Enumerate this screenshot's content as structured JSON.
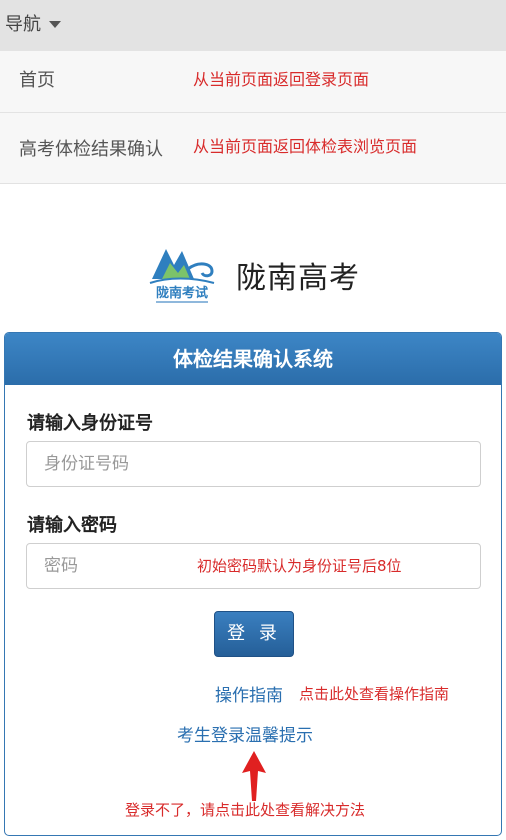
{
  "topbar": {
    "nav_label": "导航"
  },
  "menu": {
    "items": [
      {
        "label": "首页",
        "annotation": "从当前页面返回登录页面"
      },
      {
        "label": "高考体检结果确认",
        "annotation": "从当前页面返回体检表浏览页面"
      }
    ]
  },
  "brand": {
    "name": "陇南高考",
    "logo_text": "陇南考试"
  },
  "panel": {
    "title": "体检结果确认系统",
    "id_label": "请输入身份证号",
    "id_placeholder": "身份证号码",
    "password_label": "请输入密码",
    "password_placeholder": "密码",
    "password_annotation": "初始密码默认为身份证号后8位",
    "login_button": "登 录",
    "guide_link": "操作指南",
    "guide_annotation": "点击此处查看操作指南",
    "tips_link": "考生登录温馨提示",
    "tips_annotation": "登录不了，请点击此处查看解决方法"
  },
  "colors": {
    "accent_blue": "#2b6daa",
    "annotation_red": "#d82b2b",
    "topbar_gray": "#e3e3e3"
  }
}
